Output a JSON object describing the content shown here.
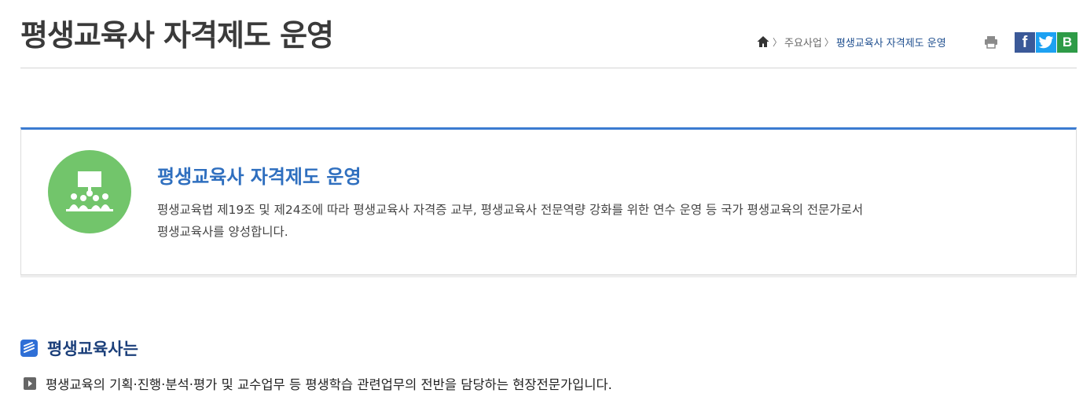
{
  "page": {
    "title": "평생교육사 자격제도 운영"
  },
  "breadcrumb": {
    "home_icon": "home-icon",
    "separator": "〉",
    "items": [
      "주요사업",
      "평생교육사 자격제도 운영"
    ]
  },
  "tools": {
    "print_icon": "print-icon",
    "sns": {
      "facebook": "f",
      "twitter": "t",
      "blog": "B"
    }
  },
  "intro": {
    "icon": "lecture-icon",
    "title": "평생교육사 자격제도 운영",
    "description_line1": "평생교육법 제19조 및 제24조에 따라 평생교육사 자격증 교부, 평생교육사 전문역량 강화를 위한 연수 운영 등 국가 평생교육의 전문가로서",
    "description_line2": "평생교육사를 양성합니다."
  },
  "section": {
    "icon": "section-icon",
    "title": "평생교육사는",
    "bullet_icon": "play-bullet-icon",
    "bullet_text": "평생교육의 기획·진행·분석·평가 및 교수업무 등 평생학습 관련업무의 전반을 담당하는 현장전문가입니다."
  },
  "colors": {
    "accent_blue": "#3b7bd1",
    "title_blue": "#2f6fbf",
    "section_navy": "#1b3f7a",
    "icon_green": "#72c56b",
    "facebook": "#3b5998",
    "twitter": "#1da1f2",
    "blog": "#2e9b47"
  }
}
